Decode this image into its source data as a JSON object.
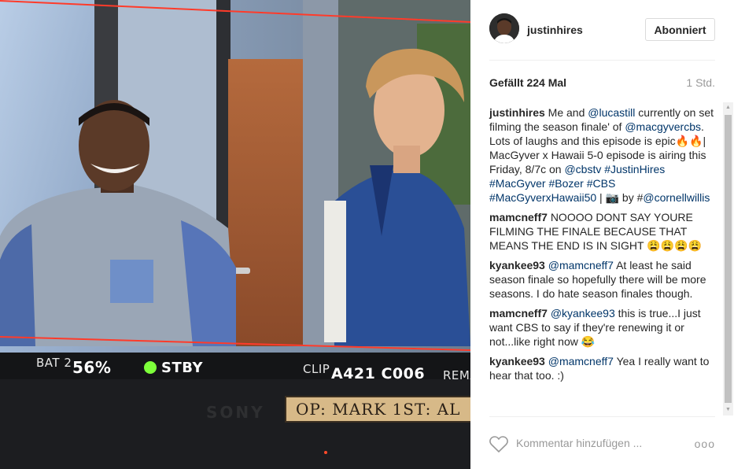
{
  "photo": {
    "battery_label": "BAT 2",
    "battery_value": "56%",
    "status": "STBY",
    "clip_label": "CLIP",
    "clip_value": "A421 C006",
    "remain_label": "REMA",
    "slate_text": "OP: MARK 1ST: AL",
    "brand": "SONY"
  },
  "post": {
    "username": "justinhires",
    "follow_label": "Abonniert",
    "likes": "Gefällt 224 Mal",
    "time": "1 Std.",
    "caption": {
      "user": "justinhires",
      "t1": " Me and ",
      "mention1": "@lucastill",
      "t2": " currently on set filming the season finale' of ",
      "mention2": "@macgyvercbs",
      "t3": ". Lots of laughs and this episode is epic🔥🔥| MacGyver x Hawaii 5-0 episode is airing this Friday, 8/7c on ",
      "mention3": "@cbstv",
      "t4": " ",
      "tags": "#JustinHires #MacGyver #Bozer #CBS #MacGyverxHawaii50",
      "t5": " | 📷 by #",
      "mention4": "@cornellwillis"
    },
    "comments": [
      {
        "user": "mamcneff7",
        "mention": "",
        "text": "NOOOO DONT SAY YOURE FILMING THE FINALE BECAUSE THAT MEANS THE END IS IN SIGHT 😩😩😩😩"
      },
      {
        "user": "kyankee93",
        "mention": "@mamcneff7",
        "text": "At least he said season finale so hopefully there will be more seasons. I do hate season finales though."
      },
      {
        "user": "mamcneff7",
        "mention": "@kyankee93",
        "text": "this is true...I just want CBS to say if they're renewing it or not...like right now 😂"
      },
      {
        "user": "kyankee93",
        "mention": "@mamcneff7",
        "text": "Yea I really want to hear that too. :)"
      }
    ],
    "comment_placeholder": "Kommentar hinzufügen ...",
    "more_label": "ooo"
  },
  "icons": {
    "heart": "heart-icon",
    "avatar": "avatar",
    "more": "more-options-icon"
  },
  "colors": {
    "link": "#003569",
    "text": "#262626",
    "muted": "#999999",
    "overlay_line": "#ff3b2a"
  }
}
